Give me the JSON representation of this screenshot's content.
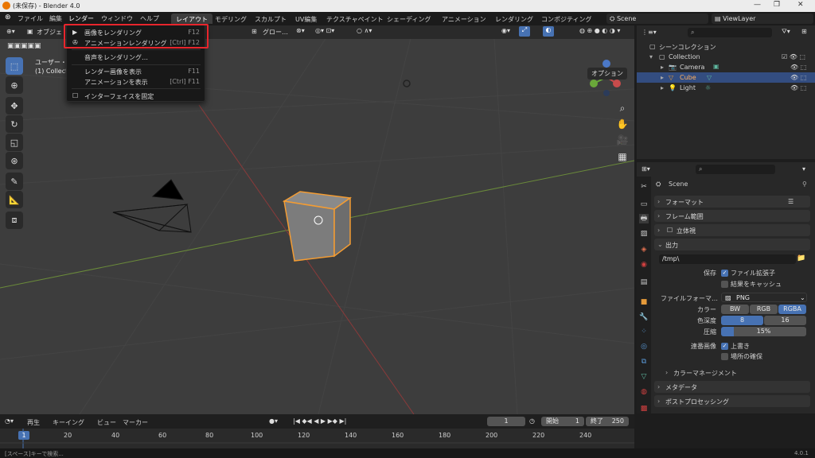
{
  "window": {
    "title": "(未保存) - Blender 4.0",
    "min": "—",
    "max": "❐",
    "close": "✕"
  },
  "menubar": {
    "file": "ファイル",
    "edit": "編集",
    "render": "レンダー",
    "window": "ウィンドウ",
    "help": "ヘルプ",
    "workspaces": [
      "レイアウト",
      "モデリング",
      "スカルプト",
      "UV編集",
      "テクスチャペイント",
      "シェーディング",
      "アニメーション",
      "レンダリング",
      "コンポジティング"
    ],
    "scene": "Scene",
    "view_layer": "ViewLayer"
  },
  "viewport": {
    "mode": "オブジェ",
    "transform": "グロー…",
    "options": "オプション",
    "overlay_text1": "ユーザー・透",
    "overlay_text2": "(1) Collectio"
  },
  "render_menu": {
    "items": [
      {
        "label": "画像をレンダリング",
        "shortcut": "F12"
      },
      {
        "label": "アニメーションレンダリング",
        "shortcut": "[Ctrl] F12"
      },
      {
        "label": "音声をレンダリング…",
        "shortcut": ""
      },
      {
        "label": "レンダー画像を表示",
        "shortcut": "F11"
      },
      {
        "label": "アニメーションを表示",
        "shortcut": "[Ctrl] F11"
      },
      {
        "label": "インターフェイスを固定",
        "shortcut": ""
      }
    ]
  },
  "outliner": {
    "scene_collection": "シーンコレクション",
    "items": [
      "Collection",
      "Camera",
      "Cube",
      "Light"
    ]
  },
  "properties": {
    "scene": "Scene",
    "panels": {
      "format": "フォーマット",
      "frame_range": "フレーム範囲",
      "stereo": "立体視",
      "output": "出力",
      "color_mgmt": "カラーマネージメント",
      "metadata": "メタデータ",
      "post": "ポストプロセッシング"
    },
    "output_path": "/tmp\\",
    "save_label": "保存",
    "file_ext": "ファイル拡張子",
    "cache": "結果をキャッシュ",
    "file_format_label": "ファイルフォーマ…",
    "file_format": "PNG",
    "color_label": "カラー",
    "color_opts": [
      "BW",
      "RGB",
      "RGBA"
    ],
    "depth_label": "色深度",
    "depth_opts": [
      "8",
      "16"
    ],
    "compression_label": "圧縮",
    "compression": "15%",
    "seq_label": "連番画像",
    "overwrite": "上書き",
    "placeholder": "場所の確保"
  },
  "timeline": {
    "playback": "再生",
    "keying": "キーイング",
    "view": "ビュー",
    "marker": "マーカー",
    "current_frame": "1",
    "start_label": "開始",
    "start": "1",
    "end_label": "終了",
    "end": "250",
    "ticks": [
      "1",
      "20",
      "40",
      "60",
      "80",
      "100",
      "120",
      "140",
      "160",
      "180",
      "200",
      "220",
      "240"
    ]
  },
  "statusbar": {
    "hint": "[スペース]キーで検索...",
    "version": "4.0.1"
  }
}
